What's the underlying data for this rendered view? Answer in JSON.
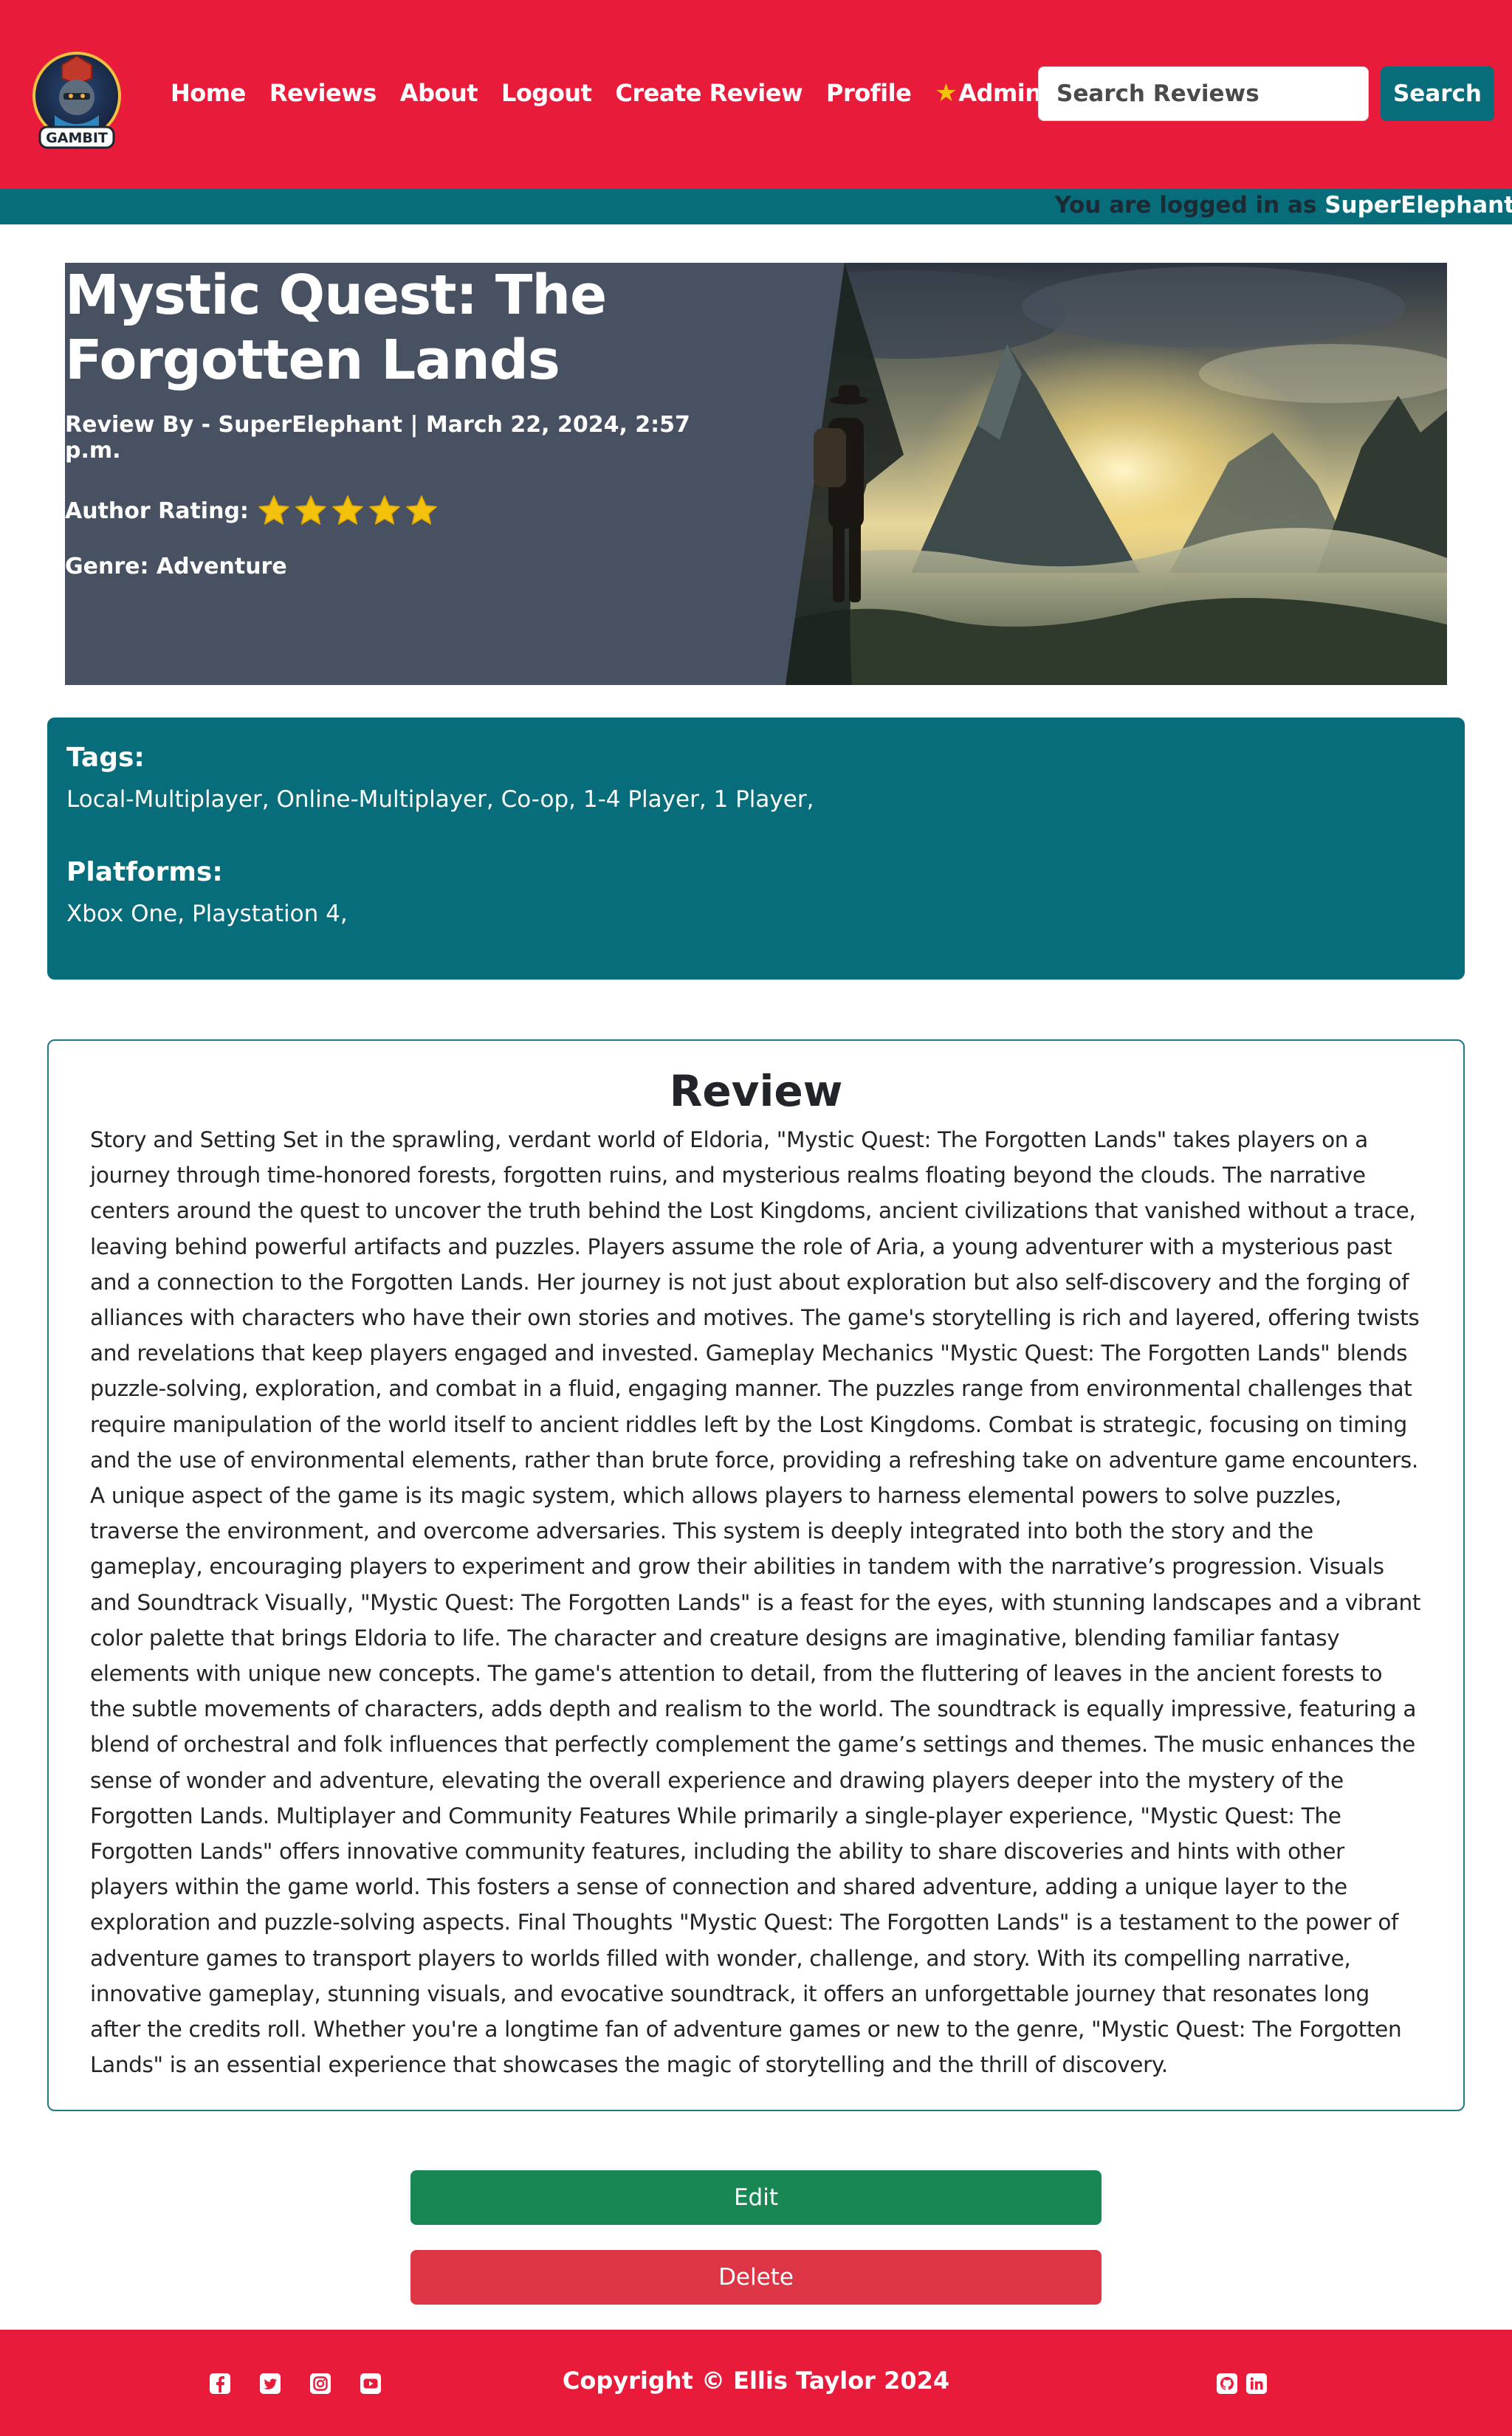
{
  "brand": {
    "logo_text": "GAMBIT"
  },
  "nav": {
    "home": "Home",
    "reviews": "Reviews",
    "about": "About",
    "logout": "Logout",
    "create_review": "Create Review",
    "profile": "Profile",
    "admin": "Admin"
  },
  "search": {
    "placeholder": "Search Reviews",
    "button": "Search"
  },
  "login_bar": {
    "prefix": "You are logged in as ",
    "username": "SuperElephant"
  },
  "review": {
    "title": "Mystic Quest: The Forgotten Lands",
    "byline": "Review By - SuperElephant | March 22, 2024, 2:57 p.m.",
    "rating_label": "Author Rating:",
    "rating": 5,
    "rating_max": 5,
    "genre": "Genre: Adventure",
    "tags_heading": "Tags:",
    "tags": "Local-Multiplayer, Online-Multiplayer, Co-op, 1-4 Player, 1 Player,",
    "platforms_heading": "Platforms:",
    "platforms": "Xbox One, Playstation 4,",
    "section_title": "Review",
    "body": "Story and Setting Set in the sprawling, verdant world of Eldoria, \"Mystic Quest: The Forgotten Lands\" takes players on a journey through time-honored forests, forgotten ruins, and mysterious realms floating beyond the clouds. The narrative centers around the quest to uncover the truth behind the Lost Kingdoms, ancient civilizations that vanished without a trace, leaving behind powerful artifacts and puzzles. Players assume the role of Aria, a young adventurer with a mysterious past and a connection to the Forgotten Lands. Her journey is not just about exploration but also self-discovery and the forging of alliances with characters who have their own stories and motives. The game's storytelling is rich and layered, offering twists and revelations that keep players engaged and invested. Gameplay Mechanics \"Mystic Quest: The Forgotten Lands\" blends puzzle-solving, exploration, and combat in a fluid, engaging manner. The puzzles range from environmental challenges that require manipulation of the world itself to ancient riddles left by the Lost Kingdoms. Combat is strategic, focusing on timing and the use of environmental elements, rather than brute force, providing a refreshing take on adventure game encounters. A unique aspect of the game is its magic system, which allows players to harness elemental powers to solve puzzles, traverse the environment, and overcome adversaries. This system is deeply integrated into both the story and the gameplay, encouraging players to experiment and grow their abilities in tandem with the narrative’s progression. Visuals and Soundtrack Visually, \"Mystic Quest: The Forgotten Lands\" is a feast for the eyes, with stunning landscapes and a vibrant color palette that brings Eldoria to life. The character and creature designs are imaginative, blending familiar fantasy elements with unique new concepts. The game's attention to detail, from the fluttering of leaves in the ancient forests to the subtle movements of characters, adds depth and realism to the world. The soundtrack is equally impressive, featuring a blend of orchestral and folk influences that perfectly complement the game’s settings and themes. The music enhances the sense of wonder and adventure, elevating the overall experience and drawing players deeper into the mystery of the Forgotten Lands. Multiplayer and Community Features While primarily a single-player experience, \"Mystic Quest: The Forgotten Lands\" offers innovative community features, including the ability to share discoveries and hints with other players within the game world. This fosters a sense of connection and shared adventure, adding a unique layer to the exploration and puzzle-solving aspects. Final Thoughts \"Mystic Quest: The Forgotten Lands\" is a testament to the power of adventure games to transport players to worlds filled with wonder, challenge, and story. With its compelling narrative, innovative gameplay, stunning visuals, and evocative soundtrack, it offers an unforgettable journey that resonates long after the credits roll. Whether you're a longtime fan of adventure games or new to the genre, \"Mystic Quest: The Forgotten Lands\" is an essential experience that showcases the magic of storytelling and the thrill of discovery."
  },
  "actions": {
    "edit": "Edit",
    "delete": "Delete"
  },
  "footer": {
    "copyright": "Copyright © Ellis Taylor 2024",
    "social_icons": [
      "facebook-icon",
      "twitter-icon",
      "instagram-icon",
      "youtube-icon"
    ],
    "contact_icons": [
      "github-icon",
      "linkedin-icon"
    ]
  },
  "colors": {
    "primary_red": "#e81c3a",
    "teal": "#076d7a",
    "hero_bg": "#475162",
    "edit_green": "#198754",
    "delete_red": "#dc3545",
    "star_gold": "#f4c20d"
  }
}
